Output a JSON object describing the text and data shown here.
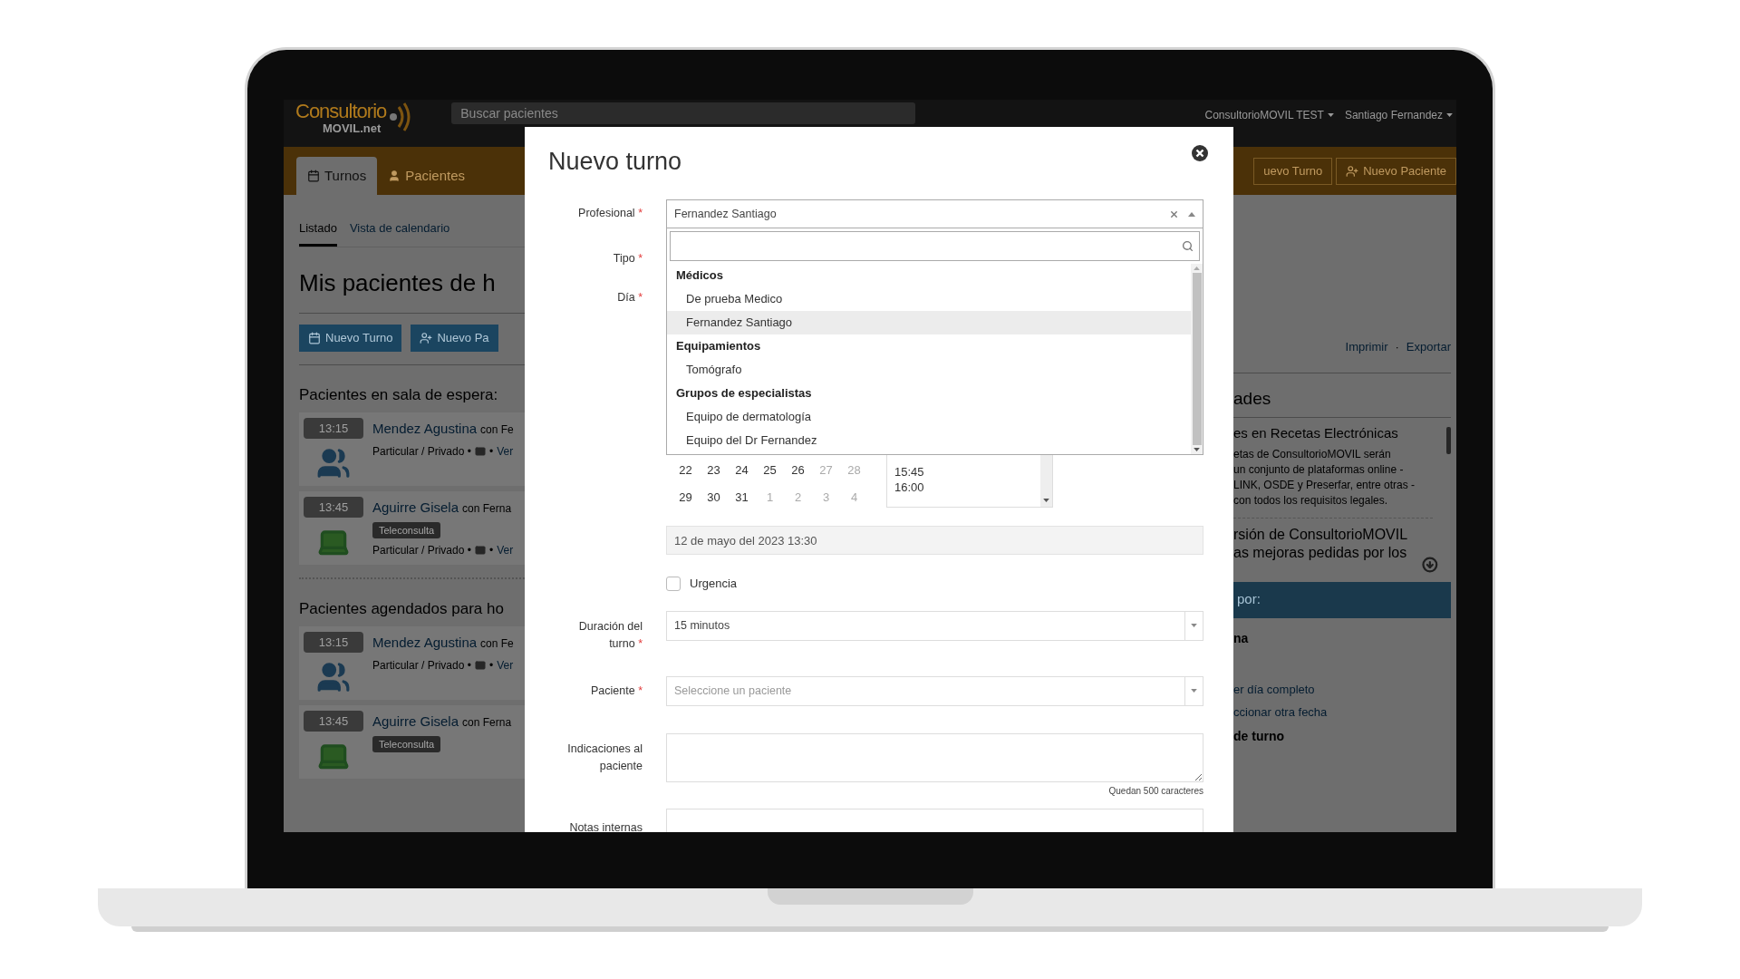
{
  "app": {
    "logo": {
      "main": "Consultorio",
      "sub": "MOVIL.net"
    },
    "search": {
      "placeholder": "Buscar pacientes"
    },
    "account": "ConsultorioMOVIL TEST",
    "user": "Santiago Fernandez",
    "nav_tabs": [
      {
        "label": "Turnos",
        "selected": true,
        "kind": "calendar"
      },
      {
        "label": "Pacientes",
        "selected": false,
        "kind": "user"
      }
    ],
    "nav_buttons": [
      {
        "label": "uevo Turno",
        "kind": "plain"
      },
      {
        "label": "Nuevo Paciente",
        "kind": "user-plus"
      }
    ],
    "sub_tabs": [
      {
        "label": "Listado",
        "selected": true
      },
      {
        "label": "Vista de calendario",
        "selected": false
      }
    ],
    "heading": "Mis pacientes de h",
    "action_buttons": [
      {
        "label": "Nuevo Turno",
        "kind": "calendar"
      },
      {
        "label": "Nuevo Pa",
        "kind": "user-plus"
      }
    ],
    "links": [
      "Imprimir",
      "Exportar"
    ],
    "links_separator": "·",
    "sections": [
      {
        "title": "Pacientes en sala de espera:",
        "appointments": [
          {
            "time": "13:15",
            "name": "Mendez Agustina",
            "with": "con Fe",
            "kind": "in_person",
            "coverage": "Particular / Privado •",
            "separator": "•",
            "link": "Ver"
          },
          {
            "time": "13:45",
            "name": "Aguirre Gisela",
            "with": "con Ferna",
            "kind": "teleconsulta",
            "tag": "Teleconsulta",
            "coverage": "Particular / Privado •",
            "separator": "•",
            "link": "Ver"
          }
        ]
      },
      {
        "title": "Pacientes agendados para ho",
        "appointments": [
          {
            "time": "13:15",
            "name": "Mendez Agustina",
            "with": "con Fe",
            "kind": "in_person",
            "coverage": "Particular / Privado •",
            "separator": "•",
            "link": "Ver"
          },
          {
            "time": "13:45",
            "name": "Aguirre Gisela",
            "with": "con Ferna",
            "kind": "teleconsulta",
            "tag": "Teleconsulta"
          }
        ]
      }
    ],
    "news": {
      "heading": "ades",
      "items": [
        {
          "title": "es en Recetas Electrónicas",
          "body": [
            "etas de ConsultorioMOVIL serán",
            "un conjunto de plataformas online -",
            "LINK, OSDE y Preserfar, entre otras -",
            "con todos los requisitos legales."
          ]
        },
        {
          "title": "rsión de ConsultorioMOVIL as mejoras pedidas por los"
        }
      ]
    },
    "filter": {
      "bar": "por:",
      "option": "na",
      "links": [
        "er día completo",
        "ccionar otra fecha"
      ],
      "subheading": "de turno"
    }
  },
  "modal": {
    "title": "Nuevo turno",
    "required_mark": "*",
    "profesional": {
      "label": "Profesional",
      "required": true,
      "value": "Fernandez Santiago",
      "open": true,
      "groups": [
        {
          "label": "Médicos",
          "options": [
            {
              "label": "De prueba Medico",
              "selected": false
            },
            {
              "label": "Fernandez Santiago",
              "selected": true
            }
          ]
        },
        {
          "label": "Equipamientos",
          "options": [
            {
              "label": "Tomógrafo",
              "selected": false
            }
          ]
        },
        {
          "label": "Grupos de especialistas",
          "options": [
            {
              "label": "Equipo de dermatología",
              "selected": false
            },
            {
              "label": "Equipo del Dr Fernandez",
              "selected": false
            }
          ]
        }
      ]
    },
    "hidden_labels": [
      {
        "label": "Tipo",
        "required": true
      },
      {
        "label": "Día",
        "required": true
      }
    ],
    "calendar": [
      [
        {
          "day": "22",
          "outside": false
        },
        {
          "day": "23",
          "outside": false
        },
        {
          "day": "24",
          "outside": false
        },
        {
          "day": "25",
          "outside": false
        },
        {
          "day": "26",
          "outside": false
        },
        {
          "day": "27",
          "outside": true
        },
        {
          "day": "28",
          "outside": true
        }
      ],
      [
        {
          "day": "29",
          "outside": false
        },
        {
          "day": "30",
          "outside": false
        },
        {
          "day": "31",
          "outside": false
        },
        {
          "day": "1",
          "outside": true
        },
        {
          "day": "2",
          "outside": true
        },
        {
          "day": "3",
          "outside": true
        },
        {
          "day": "4",
          "outside": true
        }
      ]
    ],
    "times": [
      "15:45",
      "16:00"
    ],
    "date_value": "12 de mayo del 2023 13:30",
    "urgencia": {
      "label": "Urgencia",
      "checked": false
    },
    "duracion": {
      "label": "Duración del turno",
      "required": true,
      "value": "15 minutos"
    },
    "paciente": {
      "label": "Paciente",
      "required": true,
      "placeholder": "Seleccione un paciente"
    },
    "indicaciones": {
      "label": "Indicaciones al paciente",
      "counter": "Quedan 500 caracteres"
    },
    "notas": {
      "label": "Notas internas"
    }
  }
}
